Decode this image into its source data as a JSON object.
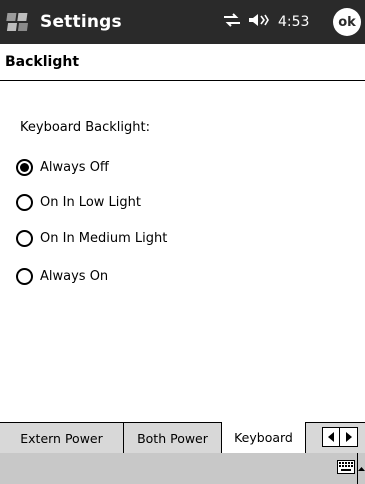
{
  "titlebar": {
    "app_title": "Settings",
    "clock": "4:53",
    "ok_label": "ok",
    "icons": [
      "start-windows-flag-icon",
      "connectivity-icon",
      "volume-icon"
    ]
  },
  "page": {
    "heading": "Backlight"
  },
  "keyboard_backlight": {
    "label": "Keyboard Backlight:",
    "options": [
      {
        "label": "Always Off",
        "selected": true
      },
      {
        "label": "On In Low Light",
        "selected": false
      },
      {
        "label": "On In Medium Light",
        "selected": false
      },
      {
        "label": "Always On",
        "selected": false
      }
    ]
  },
  "tabs": {
    "items": [
      {
        "label": "Extern Power",
        "active": false
      },
      {
        "label": "Both Power",
        "active": false
      },
      {
        "label": "Keyboard",
        "active": true
      }
    ],
    "scroll_icons": [
      "scroll-left-icon",
      "scroll-right-icon"
    ]
  },
  "bottom_bar": {
    "icons": [
      "keyboard-icon",
      "input-menu-arrow-icon"
    ]
  }
}
